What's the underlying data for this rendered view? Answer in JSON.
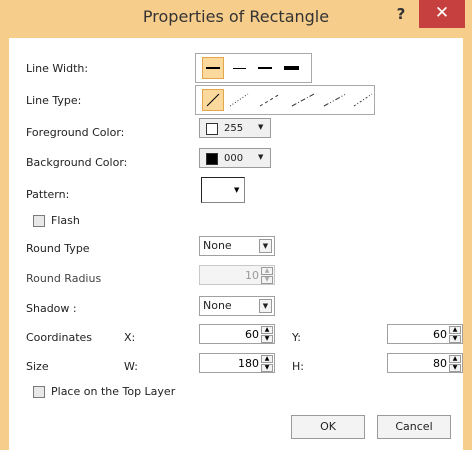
{
  "window": {
    "title": "Properties of Rectangle",
    "help_label": "?",
    "close_label": "✕",
    "accent_color": "#f7cd8c",
    "close_color": "#c74040"
  },
  "fields": {
    "line_width_label": "Line Width:",
    "line_type_label": "Line Type:",
    "foreground_label": "Foreground Color:",
    "foreground_value": "255",
    "background_label": "Background Color:",
    "background_value": "000",
    "pattern_label": "Pattern:",
    "flash_label": "Flash",
    "round_type_label": "Round Type",
    "round_type_value": "None",
    "round_radius_label": "Round Radius",
    "round_radius_value": "10",
    "shadow_label": "Shadow :",
    "shadow_value": "None",
    "coordinates_label": "Coordinates",
    "x_label": "X:",
    "x_value": "60",
    "y_label": "Y:",
    "y_value": "60",
    "size_label": "Size",
    "w_label": "W:",
    "w_value": "180",
    "h_label": "H:",
    "h_value": "80",
    "top_layer_label": "Place on the Top Layer"
  },
  "buttons": {
    "ok": "OK",
    "cancel": "Cancel"
  }
}
